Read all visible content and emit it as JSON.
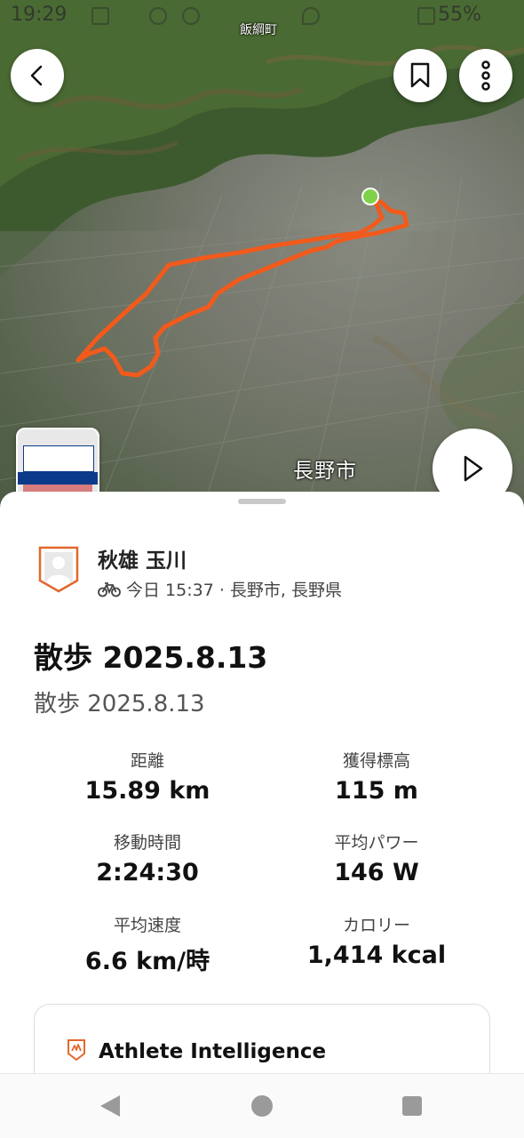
{
  "status_bar": {
    "time": "19:29",
    "battery": "55%"
  },
  "map": {
    "label_top": "飯綱町",
    "label_city": "長野市",
    "route_color": "#f25a1c",
    "start_marker_color": "#7fd14a"
  },
  "buttons": {
    "back": "chevron-left-icon",
    "bookmark": "bookmark-icon",
    "more": "more-vertical-icon",
    "play": "play-icon"
  },
  "athlete": {
    "name": "秋雄 玉川",
    "meta": "今日 15:37 · 長野市, 長野県"
  },
  "activity": {
    "title": "散歩 2025.8.13",
    "subtitle": "散歩 2025.8.13"
  },
  "stats": [
    {
      "label": "距離",
      "value": "15.89 km"
    },
    {
      "label": "獲得標高",
      "value": "115 m"
    },
    {
      "label": "移動時間",
      "value": "2:24:30"
    },
    {
      "label": "平均パワー",
      "value": "146 W"
    },
    {
      "label": "平均速度",
      "value": "6.6 km/時"
    },
    {
      "label": "カロリー",
      "value": "1,414 kcal"
    }
  ],
  "athlete_intelligence": {
    "title": "Athlete Intelligence"
  },
  "colors": {
    "accent": "#f25a1c"
  }
}
